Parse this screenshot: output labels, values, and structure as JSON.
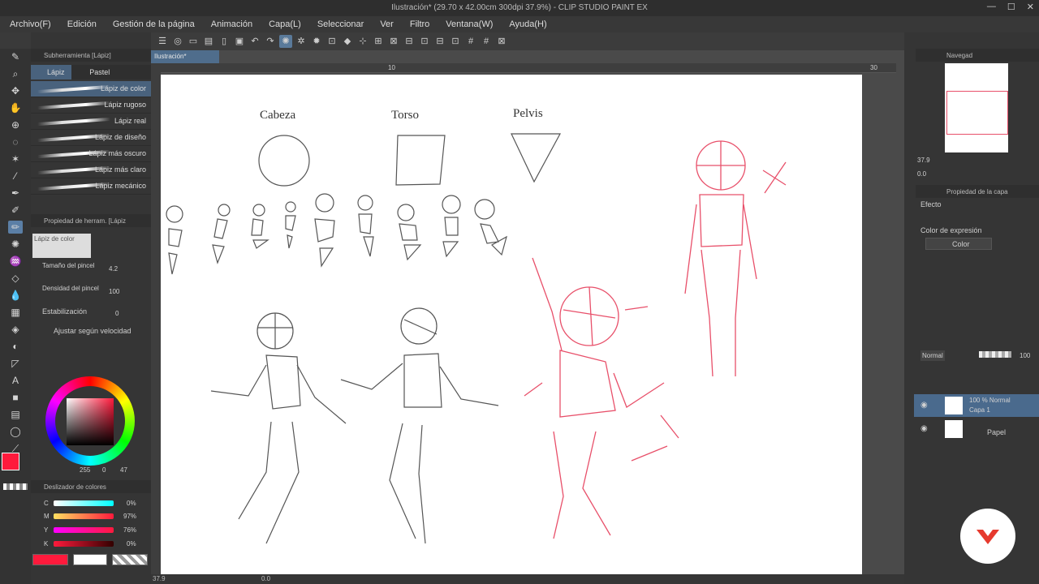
{
  "window": {
    "title": "Ilustración* (29.70 x 42.00cm 300dpi 37.9%)  - CLIP STUDIO PAINT EX"
  },
  "menu": [
    "Archivo(F)",
    "Edición",
    "Gestión de la página",
    "Animación",
    "Capa(L)",
    "Seleccionar",
    "Ver",
    "Filtro",
    "Ventana(W)",
    "Ayuda(H)"
  ],
  "subtool": {
    "header": "Subherramienta [Lápiz]",
    "tabs": [
      "Lápiz",
      "Pastel"
    ],
    "brushes": [
      "Lápiz de color",
      "Lápiz rugoso",
      "Lápiz real",
      "Lápiz de diseño",
      "Lápiz más oscuro",
      "Lápiz más claro",
      "Lápiz mecánico"
    ]
  },
  "toolprop": {
    "header": "Propiedad de herram. [Lápiz",
    "preview": "Lápiz de color",
    "size_label": "Tamaño del pincel",
    "size_value": "4.2",
    "density_label": "Densidad del pincel",
    "density_value": "100",
    "stab_label": "Estabilización",
    "stab_value": "0",
    "adjust_label": "Ajustar según velocidad"
  },
  "color": {
    "r": "255",
    "g": "0",
    "b": "47",
    "main_color": "#ff1a3c",
    "slider_header": "Deslizador de colores",
    "cmyk": [
      {
        "label": "C",
        "value": "0%"
      },
      {
        "label": "M",
        "value": "97%"
      },
      {
        "label": "Y",
        "value": "76%"
      },
      {
        "label": "K",
        "value": "0%"
      }
    ],
    "modes": "CMYK RG HS"
  },
  "document": {
    "tab": "Ilustración*",
    "ruler_10": "10",
    "ruler_30": "30",
    "zoom": "37.9",
    "rotation": "0.0"
  },
  "drawing": {
    "labels": [
      "Cabeza",
      "Torso",
      "Pelvis"
    ]
  },
  "navigator": {
    "header": "Navegad",
    "zoom": "37.9",
    "angle": "0.0"
  },
  "layerprop": {
    "header": "Propiedad de la capa",
    "effect_label": "Efecto",
    "exp_color_label": "Color de expresión",
    "exp_color_value": "Color"
  },
  "layers": {
    "blend": "Normal",
    "opacity": "100",
    "items": [
      {
        "info": "100 % Normal",
        "name": "Capa 1"
      },
      {
        "info": "",
        "name": "Papel"
      }
    ]
  }
}
